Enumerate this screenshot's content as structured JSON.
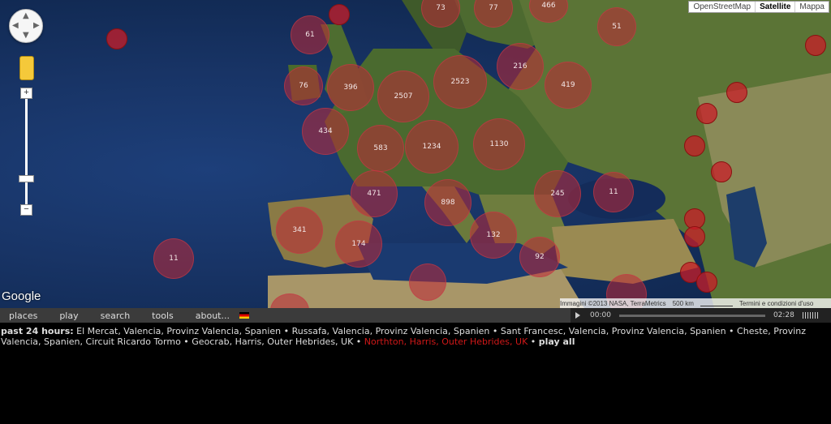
{
  "map": {
    "type_buttons": [
      "OpenStreetMap",
      "Satellite",
      "Mappa"
    ],
    "active_type": "Satellite",
    "google_logo": "Google",
    "attribution": "Immagini ©2013 NASA, TerraMetrics",
    "scale_label": "500 km",
    "terms": "Termini e condizioni d'uso",
    "clusters": [
      "73",
      "77",
      "466",
      "61",
      "51",
      "76",
      "396",
      "2523",
      "216",
      "419",
      "2507",
      "434",
      "583",
      "1234",
      "1130",
      "471",
      "898",
      "245",
      "11",
      "341",
      "174",
      "132",
      "11",
      "92"
    ]
  },
  "menu": {
    "items": [
      "places",
      "play",
      "search",
      "tools",
      "about..."
    ]
  },
  "player": {
    "current": "00:00",
    "total": "02:28"
  },
  "recent": {
    "label": "past 24 hours:",
    "places": [
      "El Mercat, Valencia, Provinz Valencia, Spanien",
      "Russafa, Valencia, Provinz Valencia, Spanien",
      "Sant Francesc, Valencia, Provinz Valencia, Spanien",
      "Cheste, Provinz Valencia, Spanien, Circuit Ricardo Tormo",
      "Geocrab, Harris, Outer Hebrides, UK",
      "Northton, Harris, Outer Hebrides, UK"
    ],
    "play_all": "play all"
  }
}
